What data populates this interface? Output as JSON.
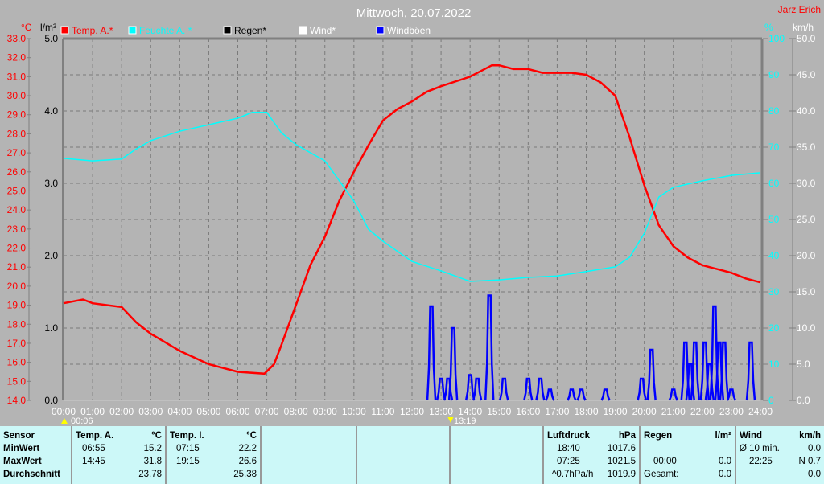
{
  "header": {
    "title": "Mittwoch, 20.07.2022",
    "author": "Jarz Erich"
  },
  "legend": [
    {
      "label": "Temp. A.*",
      "color": "#ff0000"
    },
    {
      "label": "Feuchte A. *",
      "color": "#00ffff"
    },
    {
      "label": "Regen*",
      "color": "#000000"
    },
    {
      "label": "Wind*",
      "color": "#ffffff"
    },
    {
      "label": "Windböen",
      "color": "#0000ff"
    }
  ],
  "markers": {
    "left": "00:06",
    "mid": "13:19"
  },
  "chart_data": {
    "type": "line",
    "title": "Mittwoch, 20.07.2022",
    "x_ticks": [
      "00:00",
      "01:00",
      "02:00",
      "03:00",
      "04:00",
      "05:00",
      "06:00",
      "07:00",
      "08:00",
      "09:00",
      "10:00",
      "11:00",
      "12:00",
      "13:00",
      "14:00",
      "15:00",
      "16:00",
      "17:00",
      "18:00",
      "19:00",
      "20:00",
      "21:00",
      "22:00",
      "23:00",
      "24:00"
    ],
    "axes": {
      "temp": {
        "unit": "°C",
        "range": [
          14,
          33
        ],
        "ticks": [
          "33.0",
          "32.0",
          "31.0",
          "30.0",
          "29.0",
          "28.0",
          "27.0",
          "26.0",
          "25.0",
          "24.0",
          "23.0",
          "22.0",
          "21.0",
          "20.0",
          "19.0",
          "18.0",
          "17.0",
          "16.0",
          "15.0",
          "14.0"
        ]
      },
      "rain": {
        "unit": "l/m²",
        "range": [
          0,
          5
        ],
        "ticks": [
          "5.0",
          "4.0",
          "3.0",
          "2.0",
          "1.0",
          "0.0"
        ]
      },
      "humidity": {
        "unit": "%",
        "range": [
          0,
          100
        ],
        "ticks": [
          "100",
          "90",
          "80",
          "70",
          "60",
          "50",
          "40",
          "30",
          "20",
          "10",
          "0"
        ]
      },
      "wind": {
        "unit": "km/h",
        "range": [
          0,
          50
        ],
        "ticks": [
          "50.0",
          "45.0",
          "40.0",
          "35.0",
          "30.0",
          "25.0",
          "20.0",
          "15.0",
          "10.0",
          "5.0",
          "0.0"
        ]
      }
    },
    "grid": true,
    "legend_position": "top",
    "series": [
      {
        "name": "Temp. A.*",
        "color": "#ff0000",
        "axis": "temp",
        "points": [
          [
            "00:00",
            19.1
          ],
          [
            "00:40",
            19.3
          ],
          [
            "01:00",
            19.1
          ],
          [
            "02:00",
            18.9
          ],
          [
            "02:30",
            18.1
          ],
          [
            "03:00",
            17.5
          ],
          [
            "04:00",
            16.6
          ],
          [
            "05:00",
            15.9
          ],
          [
            "06:00",
            15.5
          ],
          [
            "06:55",
            15.4
          ],
          [
            "07:15",
            15.9
          ],
          [
            "07:30",
            16.9
          ],
          [
            "08:00",
            19.0
          ],
          [
            "08:30",
            21.1
          ],
          [
            "09:00",
            22.6
          ],
          [
            "09:30",
            24.5
          ],
          [
            "10:00",
            26.0
          ],
          [
            "10:30",
            27.4
          ],
          [
            "11:00",
            28.7
          ],
          [
            "11:30",
            29.3
          ],
          [
            "12:00",
            29.7
          ],
          [
            "12:30",
            30.2
          ],
          [
            "13:00",
            30.5
          ],
          [
            "14:00",
            31.0
          ],
          [
            "14:45",
            31.6
          ],
          [
            "15:00",
            31.6
          ],
          [
            "15:30",
            31.4
          ],
          [
            "16:00",
            31.4
          ],
          [
            "16:30",
            31.2
          ],
          [
            "17:00",
            31.2
          ],
          [
            "17:30",
            31.2
          ],
          [
            "18:00",
            31.1
          ],
          [
            "18:30",
            30.7
          ],
          [
            "19:00",
            30.0
          ],
          [
            "19:30",
            27.8
          ],
          [
            "20:00",
            25.3
          ],
          [
            "20:30",
            23.2
          ],
          [
            "21:00",
            22.1
          ],
          [
            "21:30",
            21.5
          ],
          [
            "22:00",
            21.1
          ],
          [
            "22:30",
            20.9
          ],
          [
            "23:00",
            20.7
          ],
          [
            "23:30",
            20.4
          ],
          [
            "24:00",
            20.2
          ]
        ]
      },
      {
        "name": "Feuchte A. *",
        "color": "#00ffff",
        "axis": "humidity",
        "points": [
          [
            "00:00",
            66.9
          ],
          [
            "01:00",
            66.2
          ],
          [
            "02:00",
            66.7
          ],
          [
            "02:30",
            69.5
          ],
          [
            "03:00",
            71.8
          ],
          [
            "04:00",
            74.4
          ],
          [
            "05:00",
            76.2
          ],
          [
            "06:00",
            78.0
          ],
          [
            "06:30",
            79.6
          ],
          [
            "07:00",
            79.6
          ],
          [
            "07:30",
            74.0
          ],
          [
            "08:00",
            70.7
          ],
          [
            "09:00",
            66.2
          ],
          [
            "10:00",
            55.1
          ],
          [
            "10:30",
            47.3
          ],
          [
            "11:00",
            44.0
          ],
          [
            "12:00",
            38.4
          ],
          [
            "13:00",
            35.8
          ],
          [
            "14:00",
            32.9
          ],
          [
            "15:00",
            33.3
          ],
          [
            "16:00",
            34.0
          ],
          [
            "17:00",
            34.4
          ],
          [
            "18:00",
            35.6
          ],
          [
            "19:00",
            36.9
          ],
          [
            "19:30",
            39.6
          ],
          [
            "20:00",
            46.2
          ],
          [
            "20:30",
            56.2
          ],
          [
            "21:00",
            58.9
          ],
          [
            "22:00",
            60.7
          ],
          [
            "23:00",
            62.2
          ],
          [
            "24:00",
            62.9
          ]
        ]
      },
      {
        "name": "Regen*",
        "color": "#000000",
        "axis": "rain",
        "points": [
          [
            "00:00",
            0
          ],
          [
            "24:00",
            0
          ]
        ]
      },
      {
        "name": "Wind*",
        "color": "#ffffff",
        "axis": "wind",
        "points": [
          [
            "00:00",
            0
          ],
          [
            "24:00",
            0
          ]
        ]
      },
      {
        "name": "Windböen",
        "color": "#0000ff",
        "axis": "wind",
        "peaks": [
          [
            "12:40",
            13.0
          ],
          [
            "13:00",
            3.0
          ],
          [
            "13:15",
            3.0
          ],
          [
            "13:25",
            10.0
          ],
          [
            "14:00",
            3.5
          ],
          [
            "14:15",
            3.0
          ],
          [
            "14:40",
            14.5
          ],
          [
            "15:10",
            3.0
          ],
          [
            "16:00",
            3.0
          ],
          [
            "16:25",
            3.0
          ],
          [
            "16:45",
            1.5
          ],
          [
            "17:30",
            1.5
          ],
          [
            "17:50",
            1.5
          ],
          [
            "18:40",
            1.5
          ],
          [
            "19:55",
            3.0
          ],
          [
            "20:15",
            7.0
          ],
          [
            "21:00",
            1.5
          ],
          [
            "21:25",
            8.0
          ],
          [
            "21:35",
            5.0
          ],
          [
            "21:45",
            8.0
          ],
          [
            "22:05",
            8.0
          ],
          [
            "22:15",
            5.0
          ],
          [
            "22:25",
            13.0
          ],
          [
            "22:35",
            8.0
          ],
          [
            "22:45",
            8.0
          ],
          [
            "23:00",
            1.5
          ],
          [
            "23:40",
            8.0
          ]
        ]
      }
    ]
  },
  "table": {
    "sensor": {
      "header": "Sensor",
      "rows": [
        "MinWert",
        "MaxWert",
        "Durchschnitt"
      ]
    },
    "temp_a": {
      "header": "Temp. A.",
      "unit": "°C",
      "min_time": "06:55",
      "min": "15.2",
      "max_time": "14:45",
      "max": "31.8",
      "avg": "23.78"
    },
    "temp_i": {
      "header": "Temp. I.",
      "unit": "°C",
      "min_time": "07:15",
      "min": "22.2",
      "max_time": "19:15",
      "max": "26.6",
      "avg": "25.38"
    },
    "pressure": {
      "header": "Luftdruck",
      "unit": "hPa",
      "min_time": "18:40",
      "min": "1017.6",
      "max_time": "07:25",
      "max": "1021.5",
      "trend": "^0.7hPa/h",
      "avg": "1019.9"
    },
    "rain": {
      "header": "Regen",
      "unit": "l/m²",
      "max_time": "00:00",
      "max": "0.0",
      "total_label": "Gesamt:",
      "total": "0.0"
    },
    "wind": {
      "header": "Wind",
      "unit": "km/h",
      "avg_label": "Ø 10 min.",
      "avg": "0.0",
      "max_time": "22:25",
      "max": "N 0.7",
      "last": "0.0"
    }
  }
}
